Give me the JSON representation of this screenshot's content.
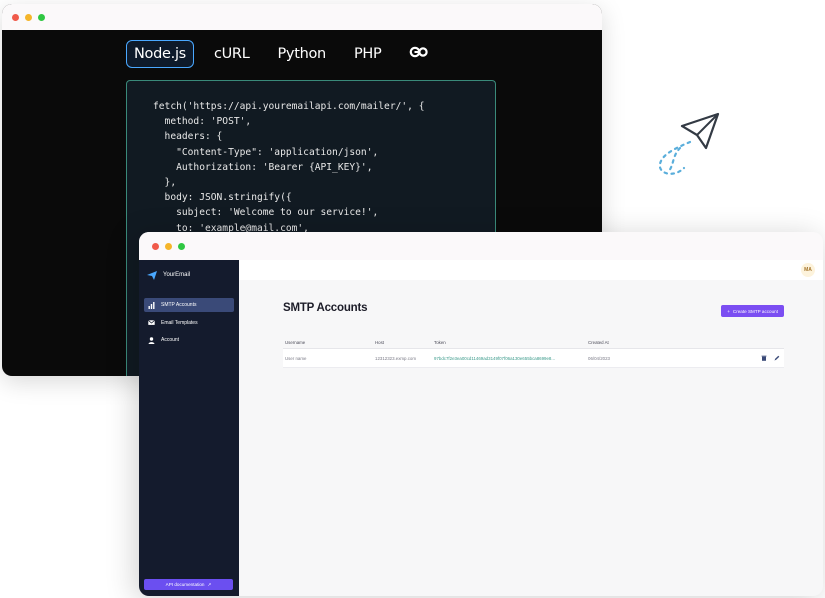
{
  "code_window": {
    "tabs": [
      {
        "label": "Node.js",
        "active": true
      },
      {
        "label": "cURL",
        "active": false
      },
      {
        "label": "Python",
        "active": false
      },
      {
        "label": "PHP",
        "active": false
      },
      {
        "label": "Go",
        "active": false
      }
    ],
    "code_lines": [
      "fetch('https://api.youremailapi.com/mailer/', {",
      "  method: 'POST',",
      "  headers: {",
      "    \"Content-Type\": 'application/json',",
      "    Authorization: 'Bearer {API_KEY}',",
      "  },",
      "  body: JSON.stringify({",
      "    subject: 'Welcome to our service!',",
      "    to: 'example@mail.com',"
    ]
  },
  "dashboard": {
    "brand": "YourEmail",
    "nav": [
      {
        "label": "SMTP Accounts",
        "icon": "chart-icon",
        "active": true
      },
      {
        "label": "Email Templates",
        "icon": "mail-icon",
        "active": false
      },
      {
        "label": "Account",
        "icon": "user-icon",
        "active": false
      }
    ],
    "api_button": "API documentation",
    "avatar_initials": "MA",
    "page_title": "SMTP Accounts",
    "create_button": "Create SMTP account",
    "table": {
      "headers": [
        "Username",
        "Host",
        "Token",
        "Created At"
      ],
      "rows": [
        {
          "username": "User name",
          "host": "12312323.exmp.com",
          "token": "97bdc7f2e3ea00cd11469ad3149f07f06a130e655bca8699e8...",
          "created_at": "06/04/2023"
        }
      ]
    }
  },
  "colors": {
    "accent": "#7b4ef2",
    "sidebar": "#141b2d",
    "code_bg": "#0a0a0a",
    "tab_border": "#4aa8ff"
  }
}
